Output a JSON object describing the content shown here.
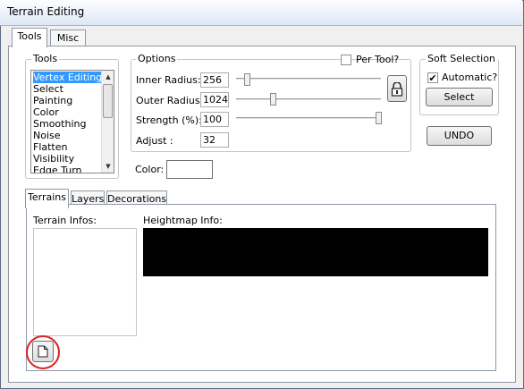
{
  "window": {
    "title": "Terrain Editing"
  },
  "top_tabs": [
    {
      "label": "Tools",
      "active": true
    },
    {
      "label": "Misc",
      "active": false
    }
  ],
  "tools_group": {
    "label": "Tools",
    "items": [
      "Vertex Editing",
      "Select",
      "Painting",
      "Color",
      "Smoothing",
      "Noise",
      "Flatten",
      "Visibility",
      "Edge Turn"
    ],
    "selected": "Vertex Editing"
  },
  "options": {
    "label": "Options",
    "per_tool_label": "Per Tool?",
    "per_tool_checked": false,
    "inner_radius": {
      "label": "Inner Radius:",
      "value": "256"
    },
    "outer_radius": {
      "label": "Outer Radius:",
      "value": "1024"
    },
    "strength": {
      "label": "Strength (%):",
      "value": "100"
    },
    "adjust": {
      "label": "Adjust :",
      "value": "32"
    },
    "lock_icon": "lock-icon"
  },
  "soft_selection": {
    "label": "Soft Selection",
    "automatic_label": "Automatic?",
    "automatic_checked": true,
    "check_mark": "✔",
    "select_button": "Select"
  },
  "undo_button": "UNDO",
  "color": {
    "label": "Color:",
    "value": "#ffffff"
  },
  "lower_tabs": [
    {
      "label": "Terrains",
      "active": true
    },
    {
      "label": "Layers",
      "active": false
    },
    {
      "label": "Decorations",
      "active": false
    }
  ],
  "terrain_infos_label": "Terrain Infos:",
  "heightmap_info_label": "Heightmap Info:",
  "new_button_icon": "new-document-icon"
}
